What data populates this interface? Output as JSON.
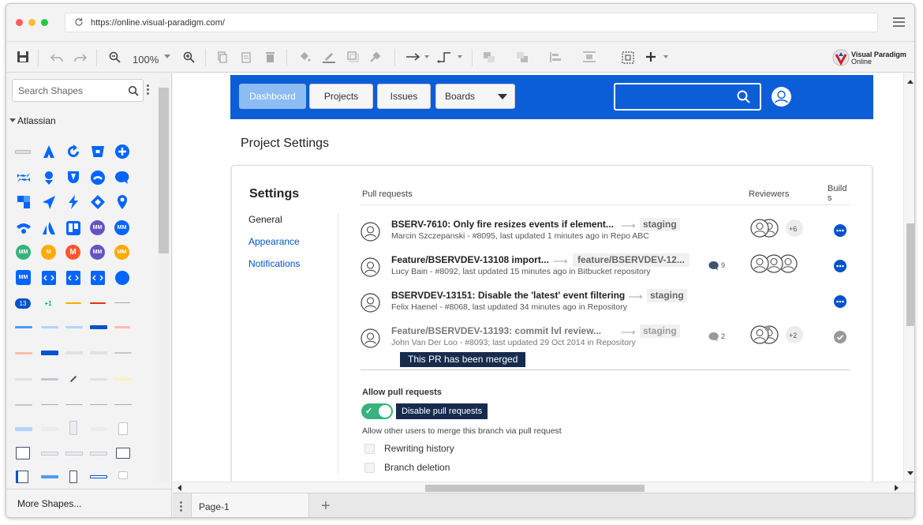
{
  "browser": {
    "url": "https://online.visual-paradigm.com/",
    "dot_colors": [
      "#ff5f57",
      "#febc2e",
      "#28c840"
    ]
  },
  "toolbar": {
    "zoom_level": "100%",
    "logo_line1": "Visual Paradigm",
    "logo_line2": "Online"
  },
  "left_panel": {
    "search_placeholder": "Search Shapes",
    "category": "Atlassian",
    "more_shapes": "More Shapes...",
    "avatar_badges": [
      "MM",
      "MM",
      "MM",
      "M",
      "MM",
      "MM",
      "MM"
    ],
    "badge_13": "13",
    "badge_plus1": "+1"
  },
  "page_tabs": {
    "current": "Page-1"
  },
  "mockup": {
    "nav": {
      "buttons": [
        {
          "label": "Dashboard",
          "active": true
        },
        {
          "label": "Projects",
          "active": false
        },
        {
          "label": "Issues",
          "active": false
        },
        {
          "label": "Boards",
          "active": false
        }
      ]
    },
    "page_title": "Project Settings",
    "settings": {
      "title": "Settings",
      "links": [
        {
          "label": "General",
          "color": "#222222"
        },
        {
          "label": "Appearance",
          "color": "#0052cc"
        },
        {
          "label": "Notifications",
          "color": "#0052cc"
        }
      ]
    },
    "columns": {
      "pull_requests": "Pull requests",
      "reviewers": "Reviewers",
      "builds_line1": "Build",
      "builds_line2": "s"
    },
    "pull_requests": [
      {
        "title": "BSERV-7610: Only fire resizes events if element...",
        "meta": "Marcin Szczepanski - #8095, last updated 1 minutes ago in Repo ABC",
        "branch": "staging",
        "comments": "",
        "reviewers_extra": "+6",
        "build": "in-progress"
      },
      {
        "title": "Feature/BSERVDEV-13108 import...",
        "meta": "Lucy Bain - #8092, last updated 15 minutes ago in Bitbucket repository",
        "branch": "feature/BSERVDEV-12...",
        "comments": "9",
        "reviewers_extra": "",
        "build": "in-progress"
      },
      {
        "title": "BSERVDEV-13151: Disable the 'latest' event filtering",
        "meta": "Felix Haenel - #8068, last updated 34 minutes ago in Repository",
        "branch": "staging",
        "comments": "",
        "reviewers_extra": "",
        "build": "in-progress"
      },
      {
        "title": "Feature/BSERVDEV-13193: commit lvl review...",
        "meta": "John Van Der Loo - #8093; last updated 29 Oct 2014 in Repository",
        "branch": "staging",
        "comments": "2",
        "reviewers_extra": "+2",
        "build": "merged"
      }
    ],
    "merged_tooltip": "This PR has been merged",
    "allow_pull_requests": "Allow pull requests",
    "toggle_tooltip": "Disable pull requests",
    "allow_other_users": "Allow other users to merge this branch via pull request",
    "options": [
      "Rewriting history",
      "Branch deletion"
    ]
  },
  "colors": {
    "nav_blue": "#0b5ed8",
    "active_button": "#8cbcf2",
    "link_blue": "#0052cc",
    "toggle_green": "#36b37e",
    "tooltip_navy": "#172b4d"
  }
}
